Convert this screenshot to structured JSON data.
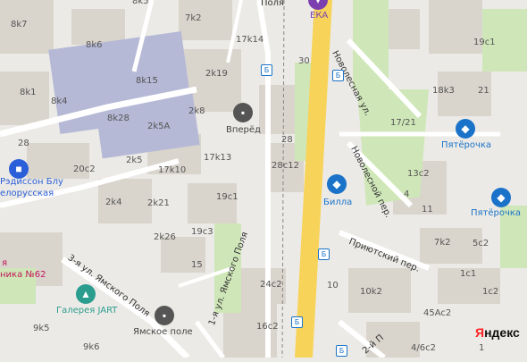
{
  "map": {
    "colors": {
      "road": "#ffffff",
      "major_road": "#f7d35a",
      "building": "#d9d4cc",
      "industrial": "#b5b9d6",
      "park": "#cfe7b8",
      "transit_stop": "#1a73c8",
      "hotel": "#2b5fd9",
      "shop": "#1a73c8",
      "museum": "#2a9d8f",
      "office": "#555555",
      "pink": "#c2185b",
      "label": "#555555"
    },
    "house_numbers": [
      "8k7",
      "8k5",
      "7k2",
      "8k6",
      "17k14",
      "30",
      "19c1",
      "8k1",
      "8k4",
      "8k15",
      "2k19",
      "18k3",
      "21",
      "8k28",
      "2k5A",
      "2k8",
      "17/21",
      "28",
      "28c12",
      "13c2",
      "20c2",
      "2k5",
      "17k10",
      "17k13",
      "4",
      "11",
      "2k4",
      "2k21",
      "19c1",
      "19c3",
      "2k26",
      "7k2",
      "5c2",
      "15",
      "1c1",
      "24c2",
      "10",
      "10k2",
      "1c2",
      "9k5",
      "9k6",
      "16c2",
      "45Ac2",
      "4/6c2",
      "1",
      "28"
    ],
    "streets": [
      "Новолесная ул.",
      "Новолесной пер.",
      "Приютский пер.",
      "3-я ул. Ямского Поля",
      "1-я ул. Ямского Поля",
      "2-й П"
    ],
    "street_top": "Поля",
    "pois": [
      {
        "name": "ЕКА",
        "icon": "store-icon"
      },
      {
        "name": "Вперёд",
        "icon": "office-icon"
      },
      {
        "name": "Пятёрочка",
        "icon": "shop-icon"
      },
      {
        "name": "Пятёрочка",
        "icon": "shop-icon"
      },
      {
        "name": "Билла",
        "icon": "shop-icon"
      },
      {
        "name": "Рэдиссон Блу",
        "icon": "hotel-icon"
      },
      {
        "name": "елорусская",
        "icon": "hotel-icon"
      },
      {
        "name": "Галерея JART",
        "icon": "museum-icon"
      },
      {
        "name": "Ямское поле",
        "icon": "office-icon"
      },
      {
        "name": "я",
        "icon": "pink"
      },
      {
        "name": "ника №62",
        "icon": "pink"
      }
    ],
    "stop_glyph": "Б",
    "attribution": "Яндекс"
  }
}
